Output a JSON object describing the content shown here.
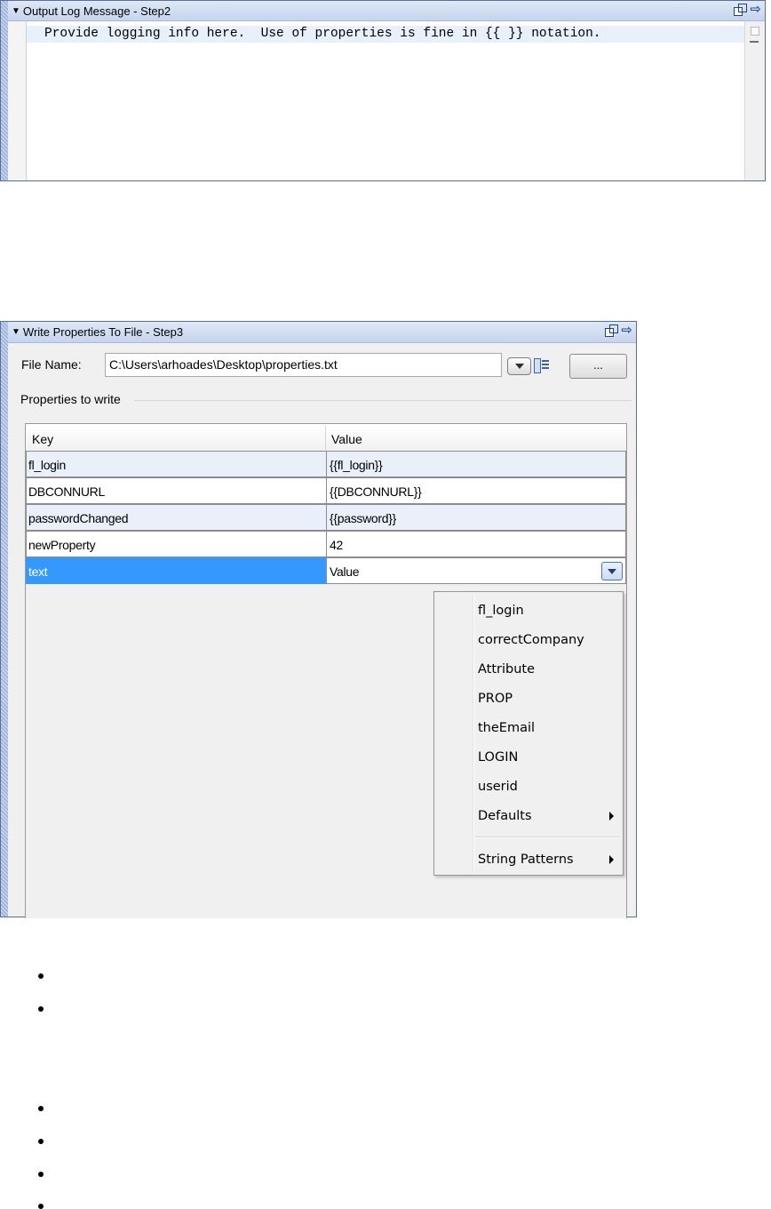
{
  "panel1": {
    "title": "Output Log Message - Step2",
    "code_text": "Provide logging info here.  Use of properties is fine in {{ }} notation."
  },
  "panel2": {
    "title": "Write Properties To File - Step3",
    "file_name_label": "File Name:",
    "file_name_value": "C:\\Users\\arhoades\\Desktop\\properties.txt",
    "browse_label": "...",
    "group_label": "Properties to write",
    "columns": [
      "Key",
      "Value"
    ],
    "rows": [
      {
        "key": "fl_login",
        "value": "{{fl_login}}"
      },
      {
        "key": "DBCONNURL",
        "value": "{{DBCONNURL}}"
      },
      {
        "key": "passwordChanged",
        "value": "{{password}}"
      },
      {
        "key": "newProperty",
        "value": "42"
      },
      {
        "key": "text",
        "value": "Value"
      }
    ],
    "menu_items": [
      "fl_login",
      "correctCompany",
      "Attribute",
      "PROP",
      "theEmail",
      "LOGIN",
      "userid",
      "Defaults",
      "String Patterns"
    ]
  },
  "colors": {
    "title_bar": "#c5d5ee",
    "selection": "#3399ff",
    "alt_row": "#e9f0fa"
  },
  "icons": [
    "triangle-down-icon",
    "undock-icon",
    "arrow-right-icon",
    "dropdown-arrow-icon",
    "list-icon",
    "submenu-arrow-icon",
    "bullet-icon"
  ]
}
